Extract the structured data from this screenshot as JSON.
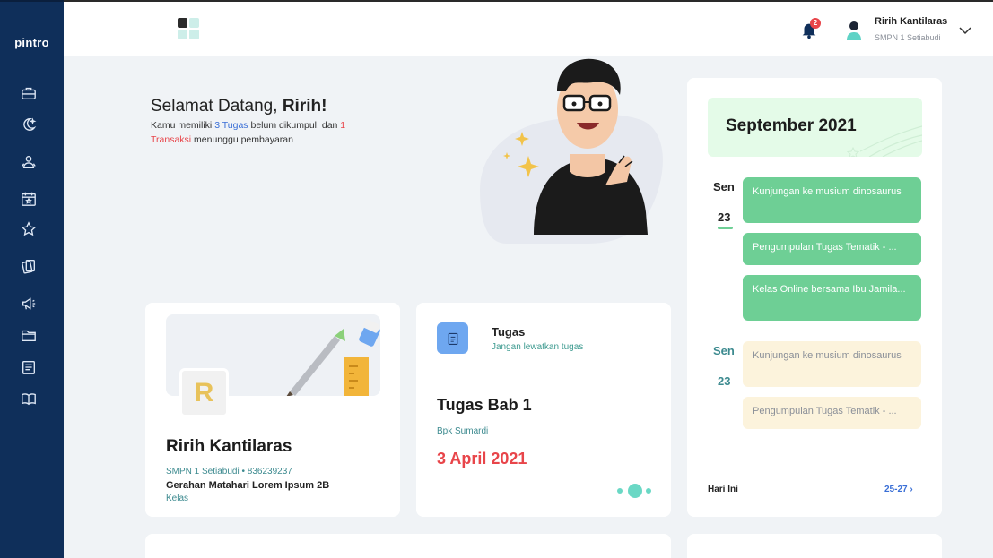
{
  "sidebar": {
    "logo": "pintro",
    "items": [
      "briefcase-icon",
      "moon-star-icon",
      "users-icon",
      "calendar-star-icon",
      "star-icon",
      "cards-icon",
      "megaphone-icon",
      "folder-icon",
      "notes-icon",
      "book-icon"
    ]
  },
  "topbar": {
    "notification_count": "2",
    "user_name": "Ririh Kantilaras",
    "user_school": "SMPN 1 Setiabudi"
  },
  "welcome": {
    "greeting": "Selamat Datang, ",
    "name": "Ririh!",
    "text_1": "Kamu memiliki ",
    "tasks_count": "3 Tugas",
    "text_2": " belum dikumpul, dan ",
    "transactions_count": "1",
    "transactions_word": "Transaksi",
    "text_3": " menunggu pembayaran"
  },
  "profile": {
    "initial": "R",
    "name": "Ririh Kantilaras",
    "school_line": "SMPN 1 Setiabudi • 836239237",
    "address": "Gerahan Matahari Lorem Ipsum 2B",
    "kelas": "Kelas"
  },
  "task": {
    "title": "Tugas",
    "subtitle": "Jangan lewatkan tugas",
    "name": "Tugas Bab 1",
    "teacher": "Bpk Sumardi",
    "due": "3 April 2021"
  },
  "calendar": {
    "month": "September 2021",
    "day1": {
      "label": "Sen",
      "date": "23"
    },
    "day2": {
      "label": "Sen",
      "date": "23"
    },
    "events_day1": [
      "Kunjungan ke musium dinosaurus",
      "Pengumpulan Tugas Tematik - ...",
      "Kelas Online bersama Ibu Jamila..."
    ],
    "events_day2": [
      "Kunjungan ke musium dinosaurus",
      "Pengumpulan Tugas Tematik - ..."
    ],
    "today": "Hari Ini",
    "range": "25-27 ›"
  },
  "colors": {
    "sidebar": "#0f2f5a",
    "green": "#6ecf95",
    "red": "#e8454a",
    "blue": "#3a6fd6",
    "teal": "#3c8a8f"
  }
}
